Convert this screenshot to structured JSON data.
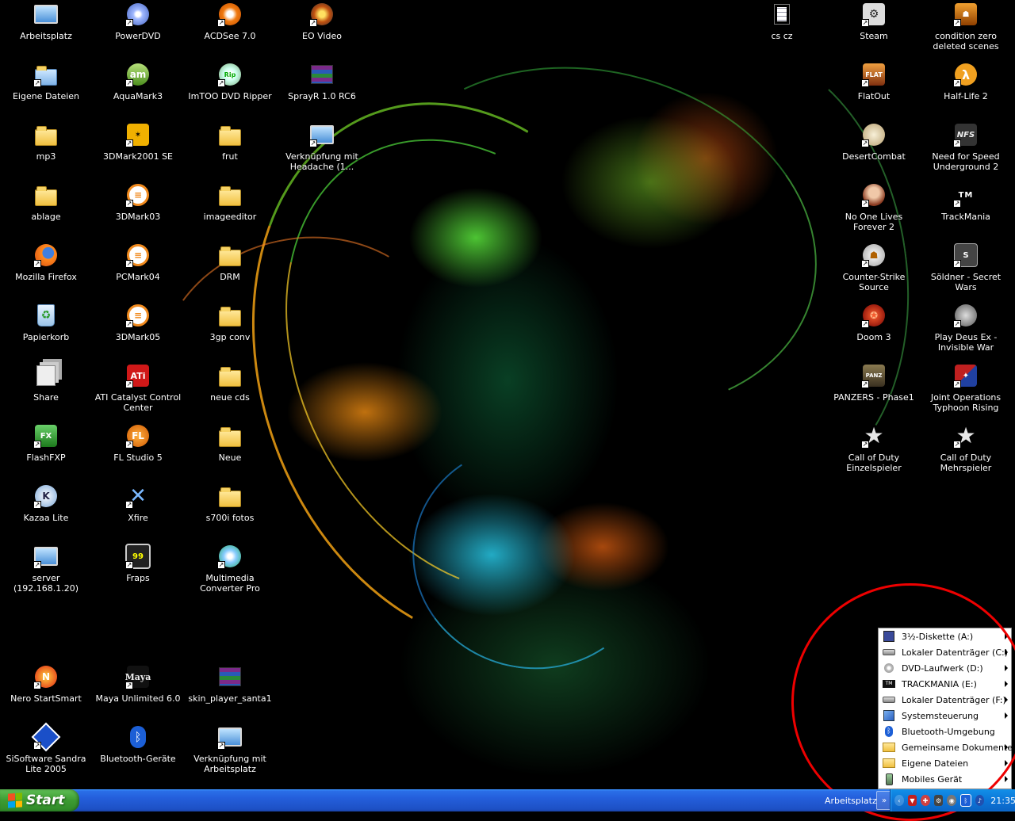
{
  "desktop": {
    "icons": [
      {
        "label": "Arbeitsplatz",
        "icon": "computer-icon"
      },
      {
        "label": "Eigene Dateien",
        "icon": "documents-folder-icon"
      },
      {
        "label": "mp3",
        "icon": "folder-icon"
      },
      {
        "label": "ablage",
        "icon": "folder-icon"
      },
      {
        "label": "Mozilla Firefox",
        "icon": "firefox-icon"
      },
      {
        "label": "Papierkorb",
        "icon": "recycle-bin-icon"
      },
      {
        "label": "Share",
        "icon": "share-icon"
      },
      {
        "label": "FlashFXP",
        "icon": "flashfxp-icon"
      },
      {
        "label": "Kazaa Lite",
        "icon": "kazaa-icon"
      },
      {
        "label": "server (192.168.1.20)",
        "icon": "network-computer-icon"
      },
      {
        "label": "Nero StartSmart",
        "icon": "nero-icon"
      },
      {
        "label": "SiSoftware Sandra Lite 2005",
        "icon": "sandra-icon"
      },
      {
        "label": "PowerDVD",
        "icon": "powerdvd-icon"
      },
      {
        "label": "AquaMark3",
        "icon": "aquamark-icon"
      },
      {
        "label": "3DMark2001 SE",
        "icon": "3dmark-icon"
      },
      {
        "label": "3DMark03",
        "icon": "futuremark-icon"
      },
      {
        "label": "PCMark04",
        "icon": "futuremark-icon"
      },
      {
        "label": "3DMark05",
        "icon": "futuremark-icon"
      },
      {
        "label": "ATI Catalyst Control Center",
        "icon": "ati-icon"
      },
      {
        "label": "FL Studio 5",
        "icon": "fl-studio-icon"
      },
      {
        "label": "Xfire",
        "icon": "xfire-icon"
      },
      {
        "label": "Fraps",
        "icon": "fraps-icon"
      },
      {
        "label": "Maya Unlimited 6.0",
        "icon": "maya-icon"
      },
      {
        "label": "Bluetooth-Geräte",
        "icon": "bluetooth-icon"
      },
      {
        "label": "ACDSee 7.0",
        "icon": "acdsee-icon"
      },
      {
        "label": "ImTOO DVD Ripper",
        "icon": "dvd-ripper-icon"
      },
      {
        "label": "frut",
        "icon": "folder-icon"
      },
      {
        "label": "imageeditor",
        "icon": "folder-icon"
      },
      {
        "label": "DRM",
        "icon": "folder-icon"
      },
      {
        "label": "3gp conv",
        "icon": "folder-icon"
      },
      {
        "label": "neue cds",
        "icon": "folder-icon"
      },
      {
        "label": "Neue",
        "icon": "folder-icon"
      },
      {
        "label": "s700i fotos",
        "icon": "folder-icon"
      },
      {
        "label": "Multimedia Converter Pro",
        "icon": "converter-icon"
      },
      {
        "label": "skin_player_santa1",
        "icon": "winrar-icon"
      },
      {
        "label": "Verknüpfung mit Arbeitsplatz",
        "icon": "computer-shortcut-icon"
      },
      {
        "label": "EO Video",
        "icon": "eo-video-icon"
      },
      {
        "label": "SprayR 1.0 RC6",
        "icon": "winrar-icon"
      },
      {
        "label": "Verknüpfung mit Headache (1...",
        "icon": "computer-shortcut-icon"
      },
      {
        "label": "cs cz",
        "icon": "text-file-icon"
      },
      {
        "label": "Steam",
        "icon": "steam-icon"
      },
      {
        "label": "FlatOut",
        "icon": "flatout-icon"
      },
      {
        "label": "DesertCombat",
        "icon": "desertcombat-icon"
      },
      {
        "label": "No One Lives Forever 2",
        "icon": "nolf2-icon"
      },
      {
        "label": "Counter-Strike Source",
        "icon": "counter-strike-icon"
      },
      {
        "label": "Doom 3",
        "icon": "doom3-icon"
      },
      {
        "label": "PANZERS - Phase1",
        "icon": "panzers-icon"
      },
      {
        "label": "Call of Duty Einzelspieler",
        "icon": "cod-star-icon"
      },
      {
        "label": "condition zero deleted scenes",
        "icon": "counter-strike-icon"
      },
      {
        "label": "Half-Life 2",
        "icon": "half-life-icon"
      },
      {
        "label": "Need for Speed Underground 2",
        "icon": "nfs-icon"
      },
      {
        "label": "TrackMania",
        "icon": "trackmania-icon"
      },
      {
        "label": "Söldner - Secret Wars",
        "icon": "soldner-icon"
      },
      {
        "label": "Play Deus Ex - Invisible War",
        "icon": "deus-ex-icon"
      },
      {
        "label": "Joint Operations Typhoon Rising",
        "icon": "joint-ops-icon"
      },
      {
        "label": "Call of Duty Mehrspieler",
        "icon": "cod-star-icon"
      }
    ]
  },
  "menu": {
    "items": [
      {
        "label": "3½-Diskette (A:)",
        "icon": "floppy-icon",
        "submenu": true
      },
      {
        "label": "Lokaler Datenträger (C:)",
        "icon": "hard-drive-icon",
        "submenu": true
      },
      {
        "label": "DVD-Laufwerk (D:)",
        "icon": "dvd-drive-icon",
        "submenu": true
      },
      {
        "label": "TRACKMANIA (E:)",
        "icon": "trackmania-drive-icon",
        "submenu": true
      },
      {
        "label": "Lokaler Datenträger (F:)",
        "icon": "hard-drive-icon",
        "submenu": true
      },
      {
        "label": "Systemsteuerung",
        "icon": "control-panel-icon",
        "submenu": true
      },
      {
        "label": "Bluetooth-Umgebung",
        "icon": "bluetooth-icon",
        "submenu": false
      },
      {
        "label": "Gemeinsame Dokumente",
        "icon": "shared-folder-icon",
        "submenu": true
      },
      {
        "label": "Eigene Dateien",
        "icon": "documents-folder-icon",
        "submenu": true
      },
      {
        "label": "Mobiles Gerät",
        "icon": "mobile-device-icon",
        "submenu": true
      }
    ]
  },
  "taskbar": {
    "start_label": "Start",
    "toolbar_label": "Arbeitsplatz",
    "chevron": "»",
    "clock": "21:35"
  },
  "colors": {
    "taskbar_blue": "#245edb",
    "start_green": "#3c9b32",
    "tray_blue": "#0c75d8",
    "annotation_red": "#e00000"
  }
}
